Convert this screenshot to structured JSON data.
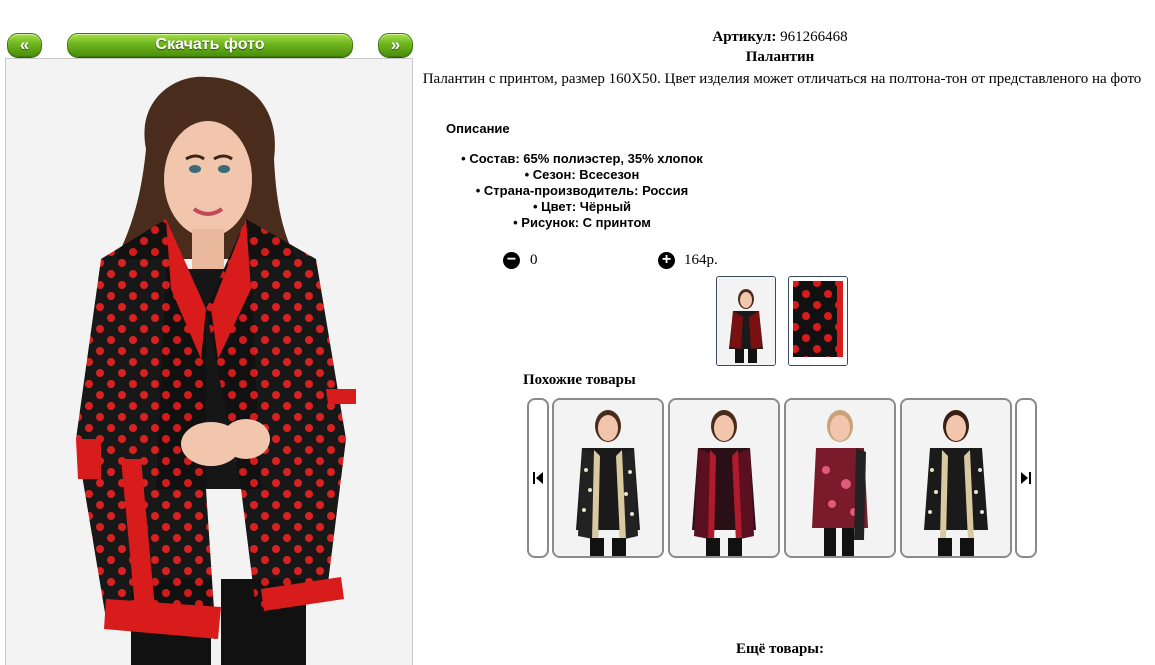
{
  "nav": {
    "prev_label": "«",
    "download_label": "Скачать фото",
    "next_label": "»"
  },
  "product": {
    "article_label": "Артикул:",
    "article_value": "961266468",
    "title": "Палантин",
    "description": "Палантин с принтом, размер 160X50. Цвет изделия может отличаться на полтона-тон от представленого на фото"
  },
  "details": {
    "heading": "Описание",
    "items": [
      "Состав: 65% полиэстер, 35% хлопок",
      "Сезон: Всесезон",
      "Страна-производитель: Россия",
      "Цвет: Чёрный",
      "Рисунок: С принтом"
    ]
  },
  "cart": {
    "quantity": "0",
    "price": "164р."
  },
  "similar": {
    "heading": "Похожие товары"
  },
  "more": {
    "heading": "Ещё товары:"
  },
  "colors": {
    "accent_green": "#6fb51e",
    "scarf_red": "#d81b1b",
    "scarf_black": "#111111"
  }
}
